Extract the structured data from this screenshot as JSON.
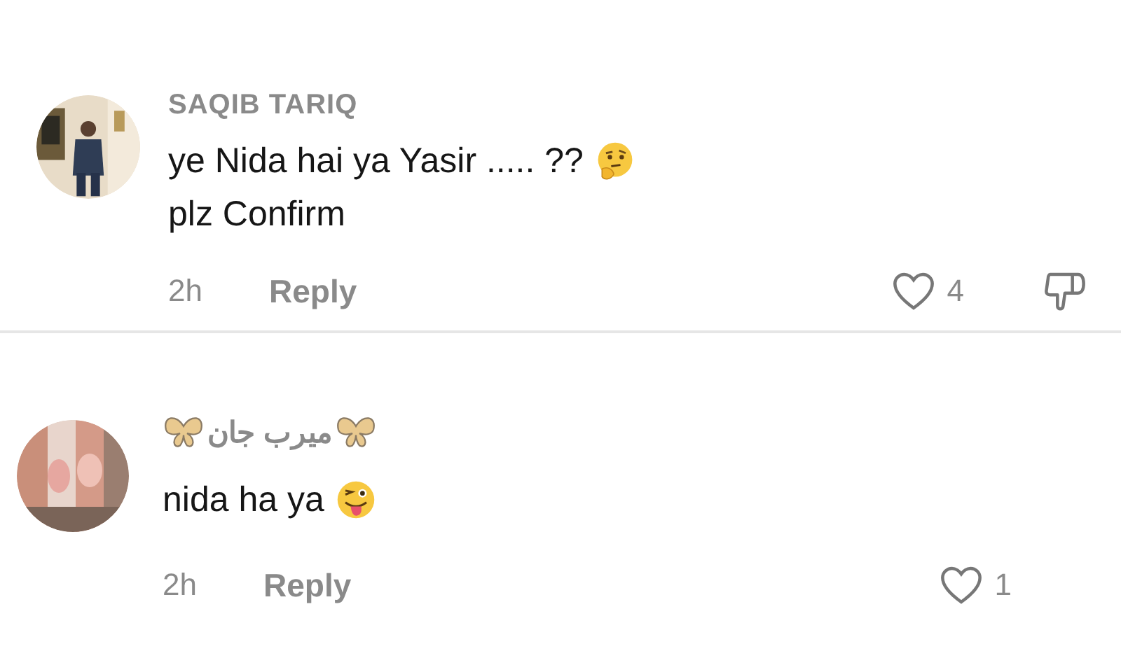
{
  "comments": [
    {
      "username": "SAQIB TARIQ",
      "kind": "plain-name",
      "avatar": {
        "kind": "picture"
      },
      "lines": [
        {
          "text": "ye Nida hai ya Yasir ..... ??",
          "kind": "thinking-emoji-line"
        },
        {
          "text": "plz Confirm",
          "kind": "text-line"
        }
      ],
      "time": "2h",
      "reply_label": "Reply",
      "likes": "4",
      "liked": false,
      "dislike_button": true
    },
    {
      "username": "ميرب جان",
      "kind": "butterfly-name",
      "avatar": {
        "kind": "picture"
      },
      "lines": [
        {
          "text": "nida ha ya",
          "kind": "wink-emoji-line"
        }
      ],
      "time": "2h",
      "reply_label": "Reply",
      "likes": "1",
      "liked": false,
      "dislike_button": false
    }
  ]
}
